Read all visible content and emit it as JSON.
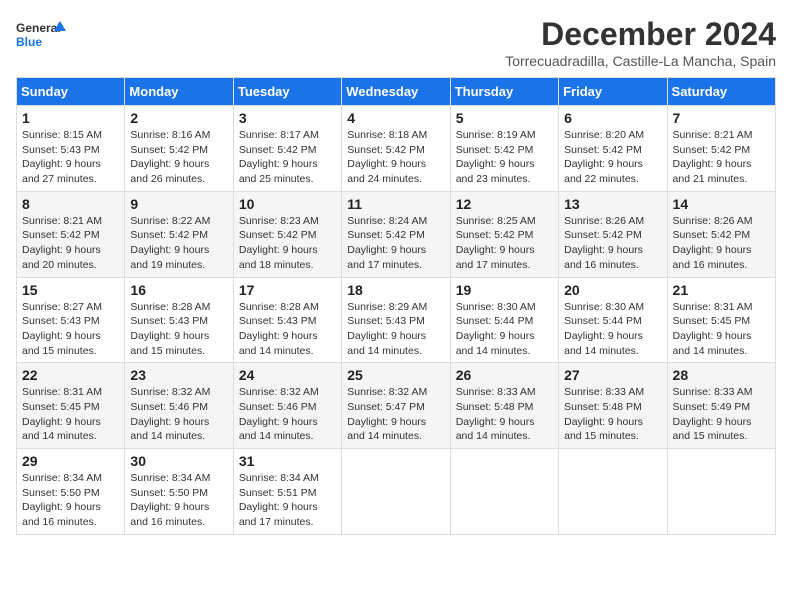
{
  "logo": {
    "line1": "General",
    "line2": "Blue"
  },
  "header": {
    "month": "December 2024",
    "location": "Torrecuadradilla, Castille-La Mancha, Spain"
  },
  "weekdays": [
    "Sunday",
    "Monday",
    "Tuesday",
    "Wednesday",
    "Thursday",
    "Friday",
    "Saturday"
  ],
  "weeks": [
    [
      {
        "day": "1",
        "sunrise": "8:15 AM",
        "sunset": "5:43 PM",
        "daylight": "9 hours and 27 minutes."
      },
      {
        "day": "2",
        "sunrise": "8:16 AM",
        "sunset": "5:42 PM",
        "daylight": "9 hours and 26 minutes."
      },
      {
        "day": "3",
        "sunrise": "8:17 AM",
        "sunset": "5:42 PM",
        "daylight": "9 hours and 25 minutes."
      },
      {
        "day": "4",
        "sunrise": "8:18 AM",
        "sunset": "5:42 PM",
        "daylight": "9 hours and 24 minutes."
      },
      {
        "day": "5",
        "sunrise": "8:19 AM",
        "sunset": "5:42 PM",
        "daylight": "9 hours and 23 minutes."
      },
      {
        "day": "6",
        "sunrise": "8:20 AM",
        "sunset": "5:42 PM",
        "daylight": "9 hours and 22 minutes."
      },
      {
        "day": "7",
        "sunrise": "8:21 AM",
        "sunset": "5:42 PM",
        "daylight": "9 hours and 21 minutes."
      }
    ],
    [
      {
        "day": "8",
        "sunrise": "8:21 AM",
        "sunset": "5:42 PM",
        "daylight": "9 hours and 20 minutes."
      },
      {
        "day": "9",
        "sunrise": "8:22 AM",
        "sunset": "5:42 PM",
        "daylight": "9 hours and 19 minutes."
      },
      {
        "day": "10",
        "sunrise": "8:23 AM",
        "sunset": "5:42 PM",
        "daylight": "9 hours and 18 minutes."
      },
      {
        "day": "11",
        "sunrise": "8:24 AM",
        "sunset": "5:42 PM",
        "daylight": "9 hours and 17 minutes."
      },
      {
        "day": "12",
        "sunrise": "8:25 AM",
        "sunset": "5:42 PM",
        "daylight": "9 hours and 17 minutes."
      },
      {
        "day": "13",
        "sunrise": "8:26 AM",
        "sunset": "5:42 PM",
        "daylight": "9 hours and 16 minutes."
      },
      {
        "day": "14",
        "sunrise": "8:26 AM",
        "sunset": "5:42 PM",
        "daylight": "9 hours and 16 minutes."
      }
    ],
    [
      {
        "day": "15",
        "sunrise": "8:27 AM",
        "sunset": "5:43 PM",
        "daylight": "9 hours and 15 minutes."
      },
      {
        "day": "16",
        "sunrise": "8:28 AM",
        "sunset": "5:43 PM",
        "daylight": "9 hours and 15 minutes."
      },
      {
        "day": "17",
        "sunrise": "8:28 AM",
        "sunset": "5:43 PM",
        "daylight": "9 hours and 14 minutes."
      },
      {
        "day": "18",
        "sunrise": "8:29 AM",
        "sunset": "5:43 PM",
        "daylight": "9 hours and 14 minutes."
      },
      {
        "day": "19",
        "sunrise": "8:30 AM",
        "sunset": "5:44 PM",
        "daylight": "9 hours and 14 minutes."
      },
      {
        "day": "20",
        "sunrise": "8:30 AM",
        "sunset": "5:44 PM",
        "daylight": "9 hours and 14 minutes."
      },
      {
        "day": "21",
        "sunrise": "8:31 AM",
        "sunset": "5:45 PM",
        "daylight": "9 hours and 14 minutes."
      }
    ],
    [
      {
        "day": "22",
        "sunrise": "8:31 AM",
        "sunset": "5:45 PM",
        "daylight": "9 hours and 14 minutes."
      },
      {
        "day": "23",
        "sunrise": "8:32 AM",
        "sunset": "5:46 PM",
        "daylight": "9 hours and 14 minutes."
      },
      {
        "day": "24",
        "sunrise": "8:32 AM",
        "sunset": "5:46 PM",
        "daylight": "9 hours and 14 minutes."
      },
      {
        "day": "25",
        "sunrise": "8:32 AM",
        "sunset": "5:47 PM",
        "daylight": "9 hours and 14 minutes."
      },
      {
        "day": "26",
        "sunrise": "8:33 AM",
        "sunset": "5:48 PM",
        "daylight": "9 hours and 14 minutes."
      },
      {
        "day": "27",
        "sunrise": "8:33 AM",
        "sunset": "5:48 PM",
        "daylight": "9 hours and 15 minutes."
      },
      {
        "day": "28",
        "sunrise": "8:33 AM",
        "sunset": "5:49 PM",
        "daylight": "9 hours and 15 minutes."
      }
    ],
    [
      {
        "day": "29",
        "sunrise": "8:34 AM",
        "sunset": "5:50 PM",
        "daylight": "9 hours and 16 minutes."
      },
      {
        "day": "30",
        "sunrise": "8:34 AM",
        "sunset": "5:50 PM",
        "daylight": "9 hours and 16 minutes."
      },
      {
        "day": "31",
        "sunrise": "8:34 AM",
        "sunset": "5:51 PM",
        "daylight": "9 hours and 17 minutes."
      },
      null,
      null,
      null,
      null
    ]
  ],
  "labels": {
    "sunrise": "Sunrise:",
    "sunset": "Sunset:",
    "daylight": "Daylight:"
  }
}
